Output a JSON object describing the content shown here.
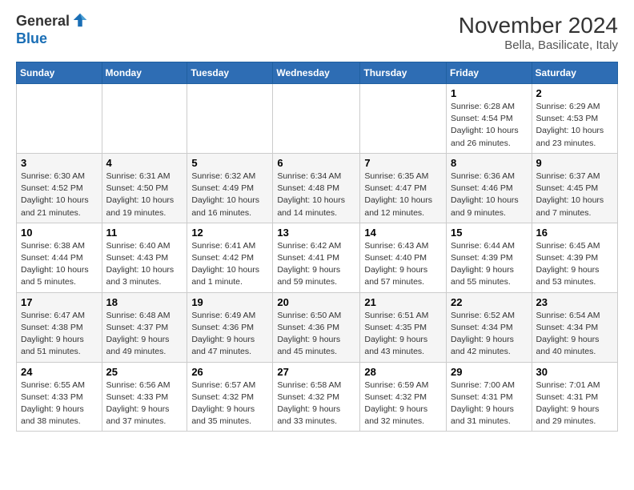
{
  "logo": {
    "general": "General",
    "blue": "Blue"
  },
  "title": "November 2024",
  "subtitle": "Bella, Basilicate, Italy",
  "days_of_week": [
    "Sunday",
    "Monday",
    "Tuesday",
    "Wednesday",
    "Thursday",
    "Friday",
    "Saturday"
  ],
  "weeks": [
    [
      {
        "day": "",
        "info": ""
      },
      {
        "day": "",
        "info": ""
      },
      {
        "day": "",
        "info": ""
      },
      {
        "day": "",
        "info": ""
      },
      {
        "day": "",
        "info": ""
      },
      {
        "day": "1",
        "info": "Sunrise: 6:28 AM\nSunset: 4:54 PM\nDaylight: 10 hours and 26 minutes."
      },
      {
        "day": "2",
        "info": "Sunrise: 6:29 AM\nSunset: 4:53 PM\nDaylight: 10 hours and 23 minutes."
      }
    ],
    [
      {
        "day": "3",
        "info": "Sunrise: 6:30 AM\nSunset: 4:52 PM\nDaylight: 10 hours and 21 minutes."
      },
      {
        "day": "4",
        "info": "Sunrise: 6:31 AM\nSunset: 4:50 PM\nDaylight: 10 hours and 19 minutes."
      },
      {
        "day": "5",
        "info": "Sunrise: 6:32 AM\nSunset: 4:49 PM\nDaylight: 10 hours and 16 minutes."
      },
      {
        "day": "6",
        "info": "Sunrise: 6:34 AM\nSunset: 4:48 PM\nDaylight: 10 hours and 14 minutes."
      },
      {
        "day": "7",
        "info": "Sunrise: 6:35 AM\nSunset: 4:47 PM\nDaylight: 10 hours and 12 minutes."
      },
      {
        "day": "8",
        "info": "Sunrise: 6:36 AM\nSunset: 4:46 PM\nDaylight: 10 hours and 9 minutes."
      },
      {
        "day": "9",
        "info": "Sunrise: 6:37 AM\nSunset: 4:45 PM\nDaylight: 10 hours and 7 minutes."
      }
    ],
    [
      {
        "day": "10",
        "info": "Sunrise: 6:38 AM\nSunset: 4:44 PM\nDaylight: 10 hours and 5 minutes."
      },
      {
        "day": "11",
        "info": "Sunrise: 6:40 AM\nSunset: 4:43 PM\nDaylight: 10 hours and 3 minutes."
      },
      {
        "day": "12",
        "info": "Sunrise: 6:41 AM\nSunset: 4:42 PM\nDaylight: 10 hours and 1 minute."
      },
      {
        "day": "13",
        "info": "Sunrise: 6:42 AM\nSunset: 4:41 PM\nDaylight: 9 hours and 59 minutes."
      },
      {
        "day": "14",
        "info": "Sunrise: 6:43 AM\nSunset: 4:40 PM\nDaylight: 9 hours and 57 minutes."
      },
      {
        "day": "15",
        "info": "Sunrise: 6:44 AM\nSunset: 4:39 PM\nDaylight: 9 hours and 55 minutes."
      },
      {
        "day": "16",
        "info": "Sunrise: 6:45 AM\nSunset: 4:39 PM\nDaylight: 9 hours and 53 minutes."
      }
    ],
    [
      {
        "day": "17",
        "info": "Sunrise: 6:47 AM\nSunset: 4:38 PM\nDaylight: 9 hours and 51 minutes."
      },
      {
        "day": "18",
        "info": "Sunrise: 6:48 AM\nSunset: 4:37 PM\nDaylight: 9 hours and 49 minutes."
      },
      {
        "day": "19",
        "info": "Sunrise: 6:49 AM\nSunset: 4:36 PM\nDaylight: 9 hours and 47 minutes."
      },
      {
        "day": "20",
        "info": "Sunrise: 6:50 AM\nSunset: 4:36 PM\nDaylight: 9 hours and 45 minutes."
      },
      {
        "day": "21",
        "info": "Sunrise: 6:51 AM\nSunset: 4:35 PM\nDaylight: 9 hours and 43 minutes."
      },
      {
        "day": "22",
        "info": "Sunrise: 6:52 AM\nSunset: 4:34 PM\nDaylight: 9 hours and 42 minutes."
      },
      {
        "day": "23",
        "info": "Sunrise: 6:54 AM\nSunset: 4:34 PM\nDaylight: 9 hours and 40 minutes."
      }
    ],
    [
      {
        "day": "24",
        "info": "Sunrise: 6:55 AM\nSunset: 4:33 PM\nDaylight: 9 hours and 38 minutes."
      },
      {
        "day": "25",
        "info": "Sunrise: 6:56 AM\nSunset: 4:33 PM\nDaylight: 9 hours and 37 minutes."
      },
      {
        "day": "26",
        "info": "Sunrise: 6:57 AM\nSunset: 4:32 PM\nDaylight: 9 hours and 35 minutes."
      },
      {
        "day": "27",
        "info": "Sunrise: 6:58 AM\nSunset: 4:32 PM\nDaylight: 9 hours and 33 minutes."
      },
      {
        "day": "28",
        "info": "Sunrise: 6:59 AM\nSunset: 4:32 PM\nDaylight: 9 hours and 32 minutes."
      },
      {
        "day": "29",
        "info": "Sunrise: 7:00 AM\nSunset: 4:31 PM\nDaylight: 9 hours and 31 minutes."
      },
      {
        "day": "30",
        "info": "Sunrise: 7:01 AM\nSunset: 4:31 PM\nDaylight: 9 hours and 29 minutes."
      }
    ]
  ]
}
